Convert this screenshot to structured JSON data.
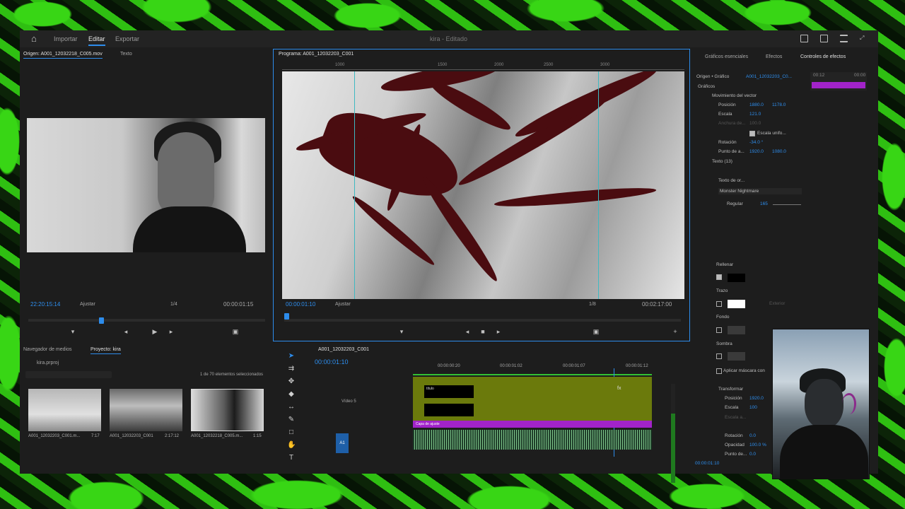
{
  "header": {
    "workspaces": [
      "Importar",
      "Editar",
      "Exportar"
    ],
    "active_workspace": "Editar",
    "title": "kira",
    "title_suffix": "- Editado"
  },
  "source": {
    "tab_label": "Origen: A001_12032218_C005.mov",
    "tab_text": "Texto",
    "timecode": "22:20:15:14",
    "fit": "Ajustar",
    "resolution": "1/4",
    "duration": "00:00:01:15"
  },
  "program": {
    "tab_label": "Programa: A001_12032203_C001",
    "timecode": "00:00:01:10",
    "fit": "Ajustar",
    "resolution": "1/8",
    "duration": "00:02:17:00",
    "ruler_labels": [
      "1000",
      "1500",
      "2000",
      "2500",
      "3000"
    ]
  },
  "project": {
    "tab_media": "Navegador de medios",
    "tab_project": "Proyecto: kira",
    "bin": "kira.prproj",
    "selection": "1 de 70 elementos seleccionados",
    "items": [
      {
        "name": "A001_12032203_C001.m...",
        "duration": "7:17"
      },
      {
        "name": "A001_12032203_C001",
        "duration": "2:17:12"
      },
      {
        "name": "A001_12032218_C005.m...",
        "duration": "1:15"
      }
    ]
  },
  "timeline": {
    "tab_label": "A001_12032203_C001",
    "timecode": "00:00:01:10",
    "time_labels": [
      "00:00:00:20",
      "00:00:01:02",
      "00:00:01:07",
      "00:00:01:12"
    ],
    "track_v5": "Vídeo 5",
    "track_a1": "A1",
    "clip_title": "título",
    "clip_adjust": "Capa de ajuste",
    "fx": "fx"
  },
  "effects": {
    "tabs": [
      "Gráficos esenciales",
      "Efectos",
      "Controles de efectos"
    ],
    "active_tab": "Controles de efectos",
    "source_label": "Origen • Gráfico",
    "clip_label": "A001_12032203_C0...",
    "mini_time_left": "00:12",
    "mini_time_right": "00:00",
    "section": "Gráficos",
    "vector_motion": "Movimiento del vector",
    "position_label": "Posición",
    "position_x": "1880.0",
    "position_y": "1178.0",
    "scale_label": "Escala",
    "scale_value": "121.0",
    "width_label": "Anchura de...",
    "width_value": "100.0",
    "uniform_scale": "Escala unifo...",
    "rotation_label": "Rotación",
    "rotation_value": "-34.0 °",
    "anchor_label": "Punto de a...",
    "anchor_x": "1920.0",
    "anchor_y": "1080.0",
    "text_layer": "Texto (13)",
    "source_text": "Texto de or...",
    "font": "Monster Nightmare",
    "font_style": "Regular",
    "font_size": "165",
    "fill_label": "Rellenar",
    "stroke_label": "Trazo",
    "stroke_value": "Exterior",
    "background_label": "Fondo",
    "shadow_label": "Sombra",
    "mask_label": "Aplicar máscara con",
    "transform_label": "Transformar",
    "t_position_label": "Posición",
    "t_position_value": "1920.0",
    "t_scale_label": "Escala",
    "t_scale_value": "100",
    "t_scale_w": "Escala a...",
    "t_rotation_label": "Rotación",
    "t_rotation_value": "0.0",
    "t_opacity_label": "Opacidad",
    "t_opacity_value": "100.0 %",
    "t_anchor_label": "Punto de...",
    "t_anchor_value": "0.0",
    "footer_time": "00:00:01:10"
  },
  "colors": {
    "accent": "#2d8ceb",
    "clip_adjust": "#a223c9",
    "clip_audio": "#1f3f2a",
    "clip_video": "#6b7a0c",
    "splatter": "#4a0c10"
  }
}
